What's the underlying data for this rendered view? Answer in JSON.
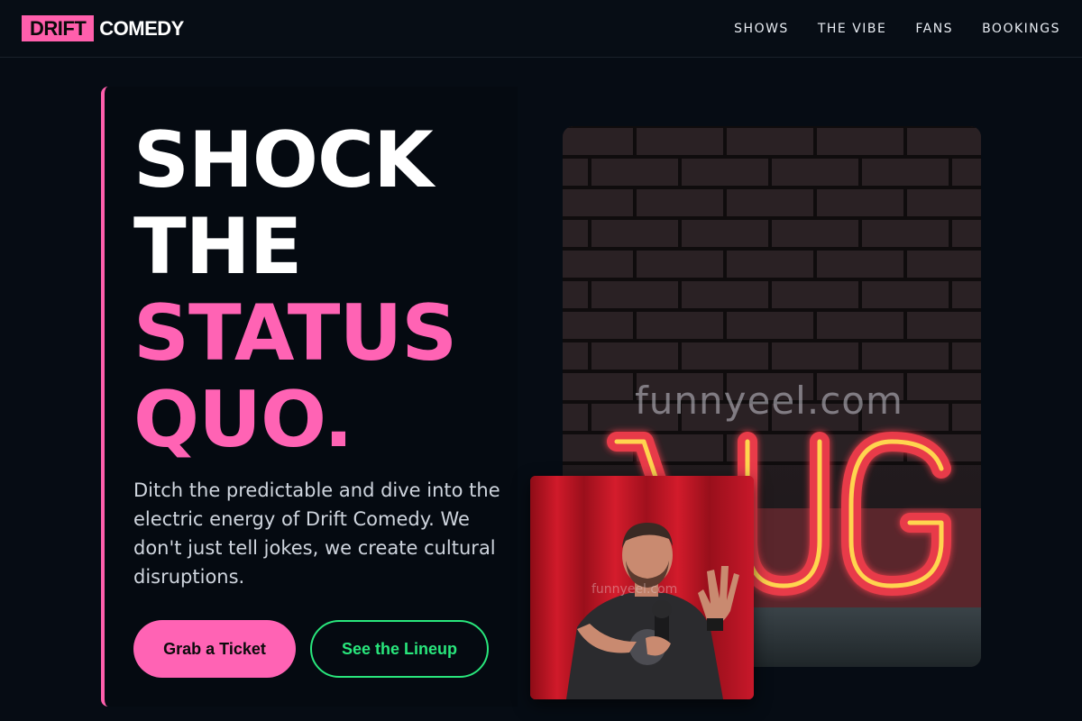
{
  "header": {
    "logo_box": "DRIFT",
    "logo_text": "COMEDY",
    "nav": [
      "SHOWS",
      "THE VIBE",
      "FANS",
      "BOOKINGS"
    ]
  },
  "hero": {
    "headline_lines": [
      "SHOCK",
      "THE",
      "STATUS",
      "QUO."
    ],
    "subcopy": "Ditch the predictable and dive into the electric energy of Drift Comedy. We don't just tell jokes, we create cultural disruptions.",
    "primary_button": "Grab a Ticket",
    "secondary_button": "See the Lineup"
  },
  "images": {
    "main_sign_text": "LAUGH",
    "watermark": "funnyeel.com",
    "watermark_small": "funnyeel.com"
  },
  "colors": {
    "accent_pink": "#ff63b4",
    "accent_green": "#29e67c",
    "background": "#060c14"
  }
}
